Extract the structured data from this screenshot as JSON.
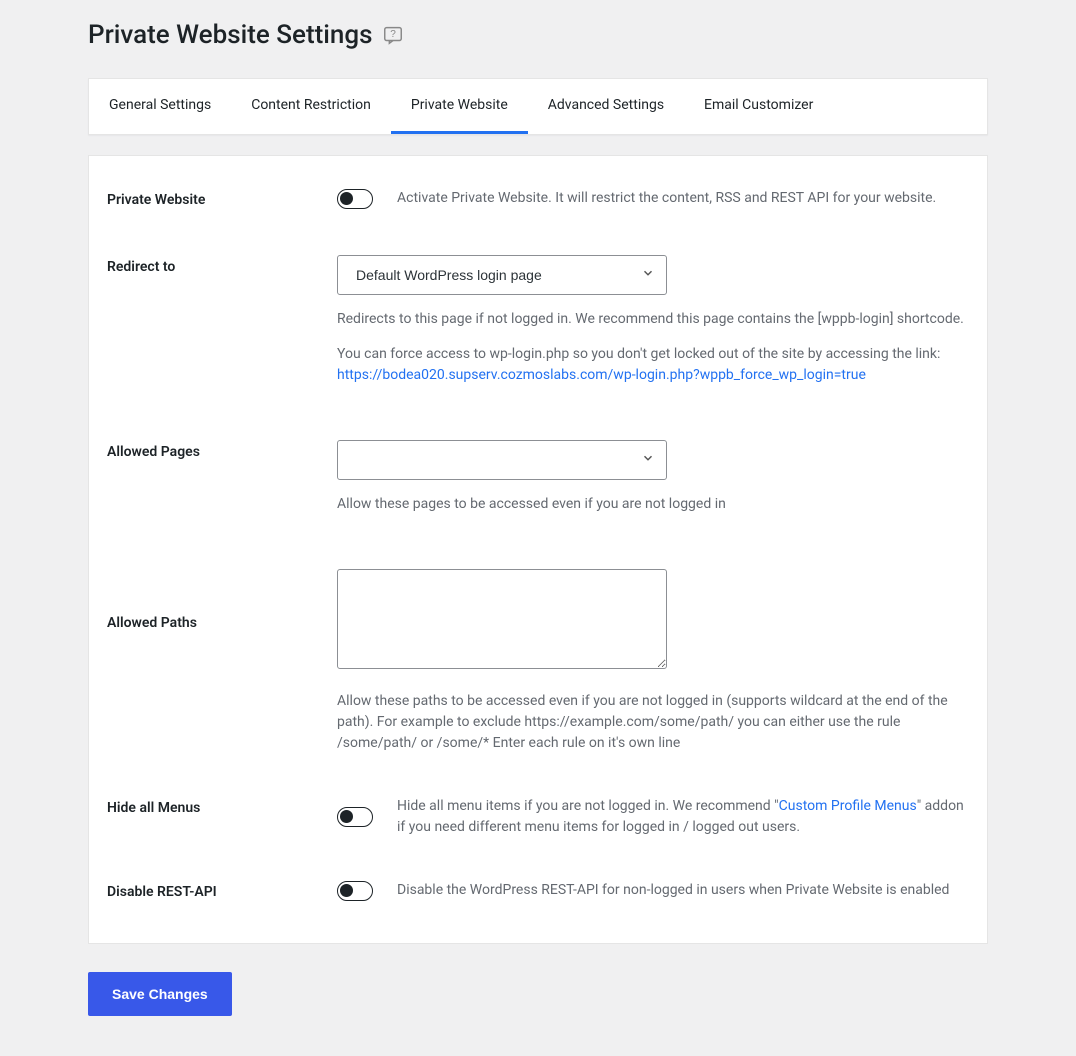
{
  "header": {
    "title": "Private Website Settings"
  },
  "tabs": {
    "general": "General Settings",
    "content_restriction": "Content Restriction",
    "private_website": "Private Website",
    "advanced_settings": "Advanced Settings",
    "email_customizer": "Email Customizer"
  },
  "form": {
    "private_website": {
      "label": "Private Website",
      "desc": "Activate Private Website. It will restrict the content, RSS and REST API for your website."
    },
    "redirect_to": {
      "label": "Redirect to",
      "selected": "Default WordPress login page",
      "desc1": "Redirects to this page if not logged in. We recommend this page contains the [wppb-login] shortcode.",
      "desc2": "You can force access to wp-login.php so you don't get locked out of the site by accessing the link: ",
      "link": "https://bodea020.supserv.cozmoslabs.com/wp-login.php?wppb_force_wp_login=true"
    },
    "allowed_pages": {
      "label": "Allowed Pages",
      "selected": "",
      "desc": "Allow these pages to be accessed even if you are not logged in"
    },
    "allowed_paths": {
      "label": "Allowed Paths",
      "value": "",
      "desc": "Allow these paths to be accessed even if you are not logged in (supports wildcard at the end of the path). For example to exclude https://example.com/some/path/ you can either use the rule /some/path/ or /some/* Enter each rule on it's own line"
    },
    "hide_menus": {
      "label": "Hide all Menus",
      "desc_pre": "Hide all menu items if you are not logged in. We recommend \"",
      "link": "Custom Profile Menus",
      "desc_post": "\" addon if you need different menu items for logged in / logged out users."
    },
    "disable_rest": {
      "label": "Disable REST-API",
      "desc": "Disable the WordPress REST-API for non-logged in users when Private Website is enabled"
    }
  },
  "buttons": {
    "save": "Save Changes"
  }
}
